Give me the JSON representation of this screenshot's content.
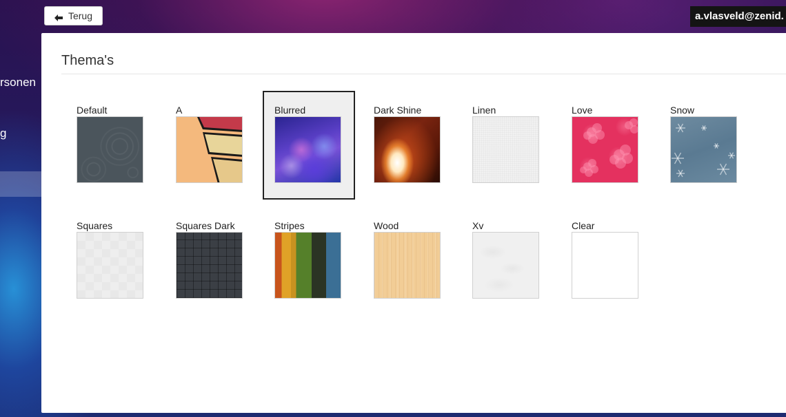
{
  "toolbar": {
    "back_label": "Terug",
    "back_icon": "arrow-left-icon"
  },
  "user": {
    "email": "a.vlasveld@zenid."
  },
  "sidebar": {
    "items": [
      {
        "label": "rsonen"
      },
      {
        "label": "g"
      }
    ]
  },
  "page": {
    "title": "Thema's"
  },
  "themes": [
    {
      "name": "Default",
      "selected": false
    },
    {
      "name": "A",
      "selected": false
    },
    {
      "name": "Blurred",
      "selected": true
    },
    {
      "name": "Dark Shine",
      "selected": false
    },
    {
      "name": "Linen",
      "selected": false
    },
    {
      "name": "Love",
      "selected": false
    },
    {
      "name": "Snow",
      "selected": false
    },
    {
      "name": "Squares",
      "selected": false
    },
    {
      "name": "Squares Dark",
      "selected": false
    },
    {
      "name": "Stripes",
      "selected": false
    },
    {
      "name": "Wood",
      "selected": false
    },
    {
      "name": "Xv",
      "selected": false
    },
    {
      "name": "Clear",
      "selected": false
    }
  ]
}
